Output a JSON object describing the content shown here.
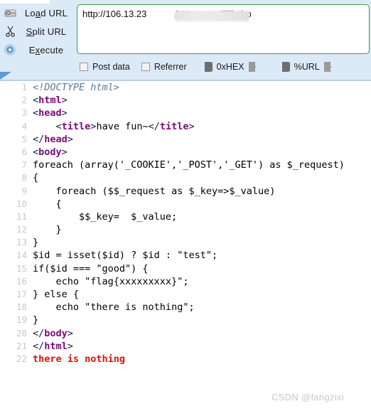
{
  "toolbar": {
    "commands": [
      {
        "id": "load-url",
        "label_pre": "Lo",
        "label_key": "a",
        "label_post": "d URL",
        "icon": "disk-icon"
      },
      {
        "id": "split-url",
        "label_pre": "",
        "label_key": "S",
        "label_post": "plit URL",
        "icon": "scissors-icon"
      },
      {
        "id": "execute",
        "label_pre": "E",
        "label_key": "x",
        "label_post": "ecute",
        "icon": "play-icon"
      }
    ],
    "url_input": {
      "value_head": "http://106.13.23",
      "value_tail": "/tttttqqqqqqllllll.php",
      "redacted": true,
      "placeholder": ""
    },
    "options": {
      "post_data_label": "Post data",
      "post_data_checked": false,
      "referrer_label": "Referrer",
      "referrer_checked": false,
      "hex_label": "0xHEX",
      "url_encode_label": "%URL"
    },
    "colors": {
      "panel_bg": "#dce9f7",
      "input_border": "#3f9a3f",
      "accent": "#5b9bd5"
    }
  },
  "code": {
    "language": "php-html",
    "colors": {
      "doctype": "#5c7a99",
      "tag": "#7b0a7b",
      "output": "#dd1111",
      "linenumber": "#c8c8c8"
    },
    "lines": [
      {
        "n": "1",
        "parts": [
          {
            "c": "t-doctype",
            "t": "<!DOCTYPE html>"
          }
        ]
      },
      {
        "n": "2",
        "parts": [
          {
            "c": "t-angle",
            "t": "<"
          },
          {
            "c": "t-tag",
            "t": "html"
          },
          {
            "c": "t-angle",
            "t": ">"
          }
        ]
      },
      {
        "n": "3",
        "parts": [
          {
            "c": "t-angle",
            "t": "<"
          },
          {
            "c": "t-tag",
            "t": "head"
          },
          {
            "c": "t-angle",
            "t": ">"
          }
        ]
      },
      {
        "n": "4",
        "parts": [
          {
            "c": "t-plain",
            "t": "    "
          },
          {
            "c": "t-angle",
            "t": "<"
          },
          {
            "c": "t-tag",
            "t": "title"
          },
          {
            "c": "t-angle",
            "t": ">"
          },
          {
            "c": "t-plain",
            "t": "have fun~"
          },
          {
            "c": "t-angle",
            "t": "</"
          },
          {
            "c": "t-tag",
            "t": "title"
          },
          {
            "c": "t-angle",
            "t": ">"
          }
        ]
      },
      {
        "n": "5",
        "parts": [
          {
            "c": "t-angle",
            "t": "</"
          },
          {
            "c": "t-tag",
            "t": "head"
          },
          {
            "c": "t-angle",
            "t": ">"
          }
        ]
      },
      {
        "n": "6",
        "parts": [
          {
            "c": "t-angle",
            "t": "<"
          },
          {
            "c": "t-tag",
            "t": "body"
          },
          {
            "c": "t-angle",
            "t": ">"
          }
        ]
      },
      {
        "n": "7",
        "parts": [
          {
            "c": "t-plain",
            "t": "foreach (array('_COOKIE','_POST','_GET') as $_request)"
          }
        ]
      },
      {
        "n": "8",
        "parts": [
          {
            "c": "t-plain",
            "t": "{"
          }
        ]
      },
      {
        "n": "9",
        "parts": [
          {
            "c": "t-plain",
            "t": "    foreach ($$_request as $_key=>$_value)"
          }
        ]
      },
      {
        "n": "10",
        "parts": [
          {
            "c": "t-plain",
            "t": "    {"
          }
        ]
      },
      {
        "n": "11",
        "parts": [
          {
            "c": "t-plain",
            "t": "        $$_key=  $_value;"
          }
        ]
      },
      {
        "n": "12",
        "parts": [
          {
            "c": "t-plain",
            "t": "    }"
          }
        ]
      },
      {
        "n": "13",
        "parts": [
          {
            "c": "t-plain",
            "t": "}"
          }
        ]
      },
      {
        "n": "14",
        "parts": [
          {
            "c": "t-plain",
            "t": "$id = isset($id) ? $id : \"test\";"
          }
        ]
      },
      {
        "n": "15",
        "parts": [
          {
            "c": "t-plain",
            "t": "if($id === \"good\") {"
          }
        ]
      },
      {
        "n": "16",
        "parts": [
          {
            "c": "t-plain",
            "t": "    echo \"flag{xxxxxxxxx}\";"
          }
        ]
      },
      {
        "n": "17",
        "parts": [
          {
            "c": "t-plain",
            "t": "} else {"
          }
        ]
      },
      {
        "n": "18",
        "parts": [
          {
            "c": "t-plain",
            "t": "    echo \"there is nothing\";"
          }
        ]
      },
      {
        "n": "19",
        "parts": [
          {
            "c": "t-plain",
            "t": "}"
          }
        ]
      },
      {
        "n": "20",
        "parts": [
          {
            "c": "t-angle",
            "t": "</"
          },
          {
            "c": "t-tag",
            "t": "body"
          },
          {
            "c": "t-angle",
            "t": ">"
          }
        ]
      },
      {
        "n": "21",
        "parts": [
          {
            "c": "t-angle",
            "t": "</"
          },
          {
            "c": "t-tag",
            "t": "html"
          },
          {
            "c": "t-angle",
            "t": ">"
          }
        ]
      },
      {
        "n": "22",
        "parts": [
          {
            "c": "t-out",
            "t": "there is nothing"
          }
        ]
      }
    ]
  },
  "watermark": {
    "text": "CSDN @fangzixi"
  }
}
